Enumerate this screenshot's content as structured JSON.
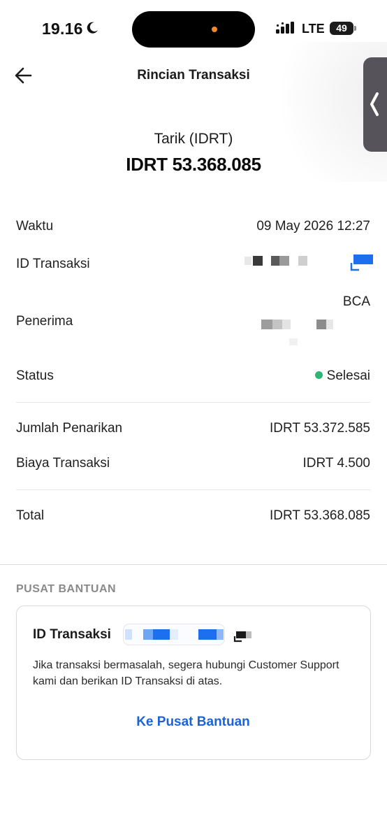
{
  "status_bar": {
    "time": "19.16",
    "network": "LTE",
    "battery": "49"
  },
  "header": {
    "title": "Rincian Transaksi"
  },
  "hero": {
    "label": "Tarik (IDRT)",
    "amount": "IDRT 53.368.085"
  },
  "details": {
    "waktu_label": "Waktu",
    "waktu_value": "09 May 2026 12:27",
    "id_label": "ID Transaksi",
    "penerima_label": "Penerima",
    "penerima_bank": "BCA",
    "status_label": "Status",
    "status_value": "Selesai",
    "jumlah_label": "Jumlah Penarikan",
    "jumlah_value": "IDRT 53.372.585",
    "biaya_label": "Biaya Transaksi",
    "biaya_value": "IDRT 4.500",
    "total_label": "Total",
    "total_value": "IDRT 53.368.085"
  },
  "help": {
    "section_title": "PUSAT BANTUAN",
    "id_label": "ID Transaksi",
    "description": "Jika transaksi bermasalah, segera hubungi Customer Support kami dan berikan ID Transaksi di atas.",
    "link_label": "Ke Pusat Bantuan"
  },
  "colors": {
    "accent": "#1e63d6",
    "success": "#2bb673",
    "text": "#1f1f1f",
    "muted": "#8a8a8a"
  },
  "icons": {
    "back": "arrow-left-icon",
    "moon": "moon-icon",
    "signal": "signal-icon",
    "handle": "chevron-left-icon",
    "copy": "copy-icon"
  }
}
